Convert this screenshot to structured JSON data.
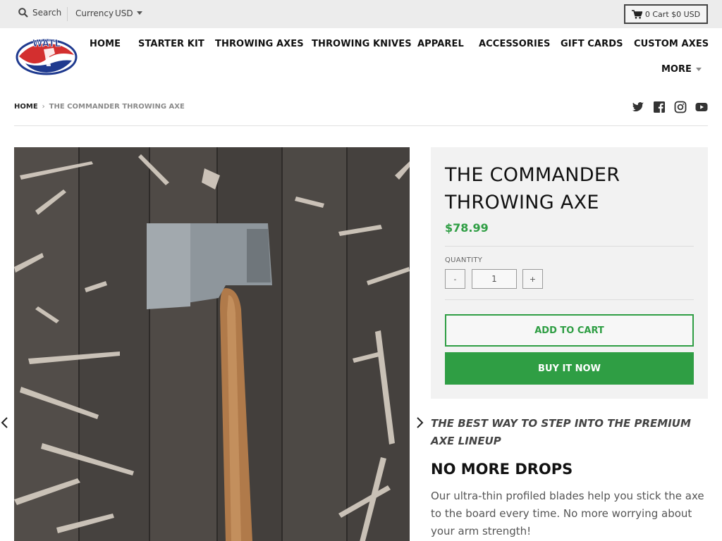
{
  "topbar": {
    "search_label": "Search",
    "currency_label": "Currency",
    "currency_value": "USD",
    "cart_label": "0 Cart $0 USD"
  },
  "logo": {
    "text": "WATL"
  },
  "nav": {
    "items": [
      {
        "label": "HOME"
      },
      {
        "label": "STARTER KIT"
      },
      {
        "label": "THROWING AXES"
      },
      {
        "label": "THROWING KNIVES"
      },
      {
        "label": "APPAREL"
      },
      {
        "label": "ACCESSORIES"
      },
      {
        "label": "GIFT CARDS"
      },
      {
        "label": "CUSTOM AXES"
      }
    ],
    "more_label": "MORE"
  },
  "breadcrumb": {
    "home": "HOME",
    "separator": "›",
    "current": "THE COMMANDER THROWING AXE"
  },
  "social": [
    "twitter-icon",
    "facebook-icon",
    "instagram-icon",
    "youtube-icon"
  ],
  "product": {
    "title": "THE COMMANDER THROWING AXE",
    "price": "$78.99",
    "quantity_label": "QUANTITY",
    "quantity_value": "1",
    "minus_label": "-",
    "plus_label": "+",
    "add_to_cart_label": "ADD TO CART",
    "buy_now_label": "BUY IT NOW",
    "tagline": "THE BEST WAY TO STEP INTO THE PREMIUM AXE LINEUP",
    "section_heading": "NO MORE DROPS",
    "section_text": "Our ultra-thin profiled blades help you stick the axe to the board every time. No more worrying about your arm strength!"
  },
  "colors": {
    "accent": "#2f9e44",
    "topbar_bg": "#ececec",
    "panel_bg": "#f2f2f2"
  }
}
